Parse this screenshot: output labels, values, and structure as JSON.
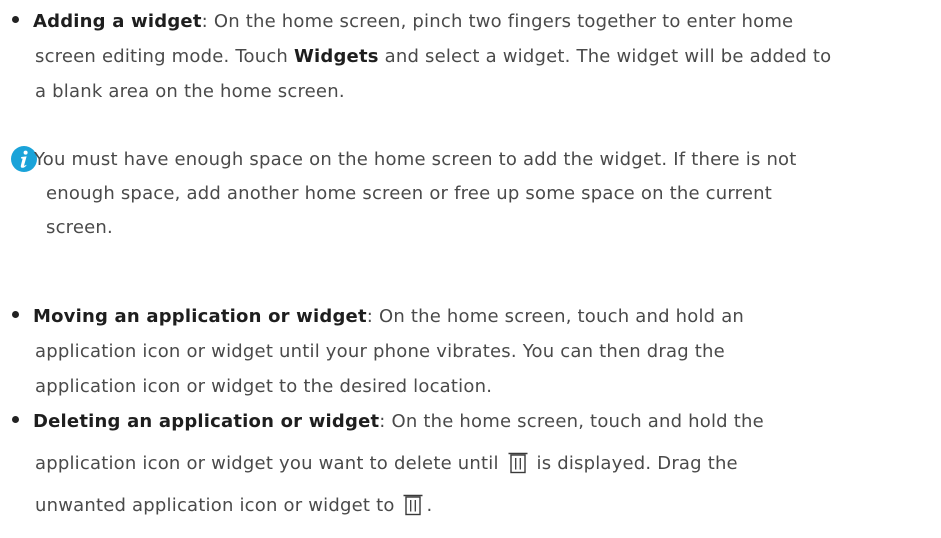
{
  "items": [
    {
      "title": "Adding a widget",
      "lines": [
        ": On the home screen, pinch two fingers together to enter home",
        "screen editing mode. Touch ",
        "Widgets",
        " and select a widget. The widget will be added to",
        "a blank area on the home screen."
      ]
    },
    {
      "title": "Moving an application or widget",
      "lines": [
        ": On the home screen, touch and hold an",
        "application icon or widget until your phone vibrates. You can then drag the",
        "application icon or widget to the desired location."
      ]
    },
    {
      "title": "Deleting an application or widget",
      "lines": [
        ": On the home screen, touch and hold the",
        "application icon or widget you want to delete until ",
        " is displayed. Drag the",
        "unwanted application icon or widget to ",
        "."
      ]
    }
  ],
  "note": {
    "lines": [
      "You must have enough space on the home screen to add the widget. If there is not",
      "enough space, add another home screen or free up some space on the current",
      "screen."
    ]
  },
  "icons": {
    "note": "info-icon",
    "delete": "trash-icon"
  },
  "colors": {
    "info_icon": "#1aa3d9",
    "text": "#4a4a4a",
    "bold_text": "#1e1e1e"
  }
}
